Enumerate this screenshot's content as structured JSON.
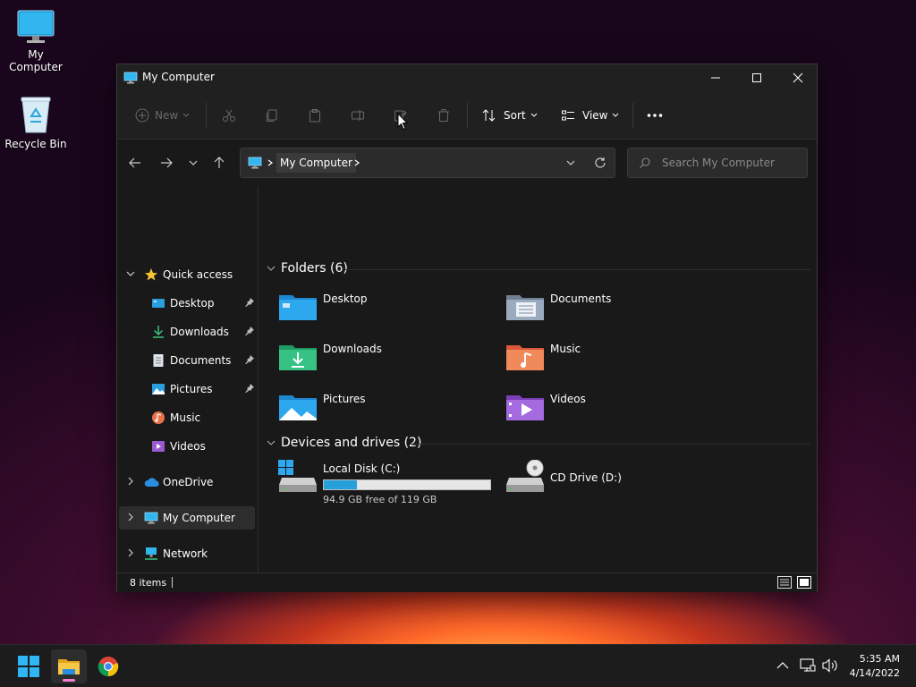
{
  "desktop": {
    "icons": [
      {
        "label": "My Computer"
      },
      {
        "label": "Recycle Bin"
      }
    ]
  },
  "window": {
    "title": "My Computer",
    "toolbar": {
      "new_label": "New",
      "sort_label": "Sort",
      "view_label": "View"
    },
    "address": {
      "crumb": "My Computer",
      "search_placeholder": "Search My Computer"
    },
    "sidebar": {
      "quick_access": "Quick access",
      "items": [
        {
          "label": "Desktop"
        },
        {
          "label": "Downloads"
        },
        {
          "label": "Documents"
        },
        {
          "label": "Pictures"
        },
        {
          "label": "Music"
        },
        {
          "label": "Videos"
        }
      ],
      "onedrive": "OneDrive",
      "my_computer": "My Computer",
      "network": "Network"
    },
    "content": {
      "folders_header": "Folders (6)",
      "folders": [
        {
          "name": "Desktop"
        },
        {
          "name": "Documents"
        },
        {
          "name": "Downloads"
        },
        {
          "name": "Music"
        },
        {
          "name": "Pictures"
        },
        {
          "name": "Videos"
        }
      ],
      "drives_header": "Devices and drives (2)",
      "drives": [
        {
          "name": "Local Disk (C:)",
          "free_text": "94.9 GB free of 119 GB",
          "used_fraction": 0.2
        },
        {
          "name": "CD Drive (D:)"
        }
      ]
    },
    "status": {
      "items_text": "8 items"
    }
  },
  "taskbar": {
    "time": "5:35 AM",
    "date": "4/14/2022"
  },
  "colors": {
    "accent": "#26a0da",
    "window_bg": "#191919",
    "titlebar_bg": "#202020"
  }
}
